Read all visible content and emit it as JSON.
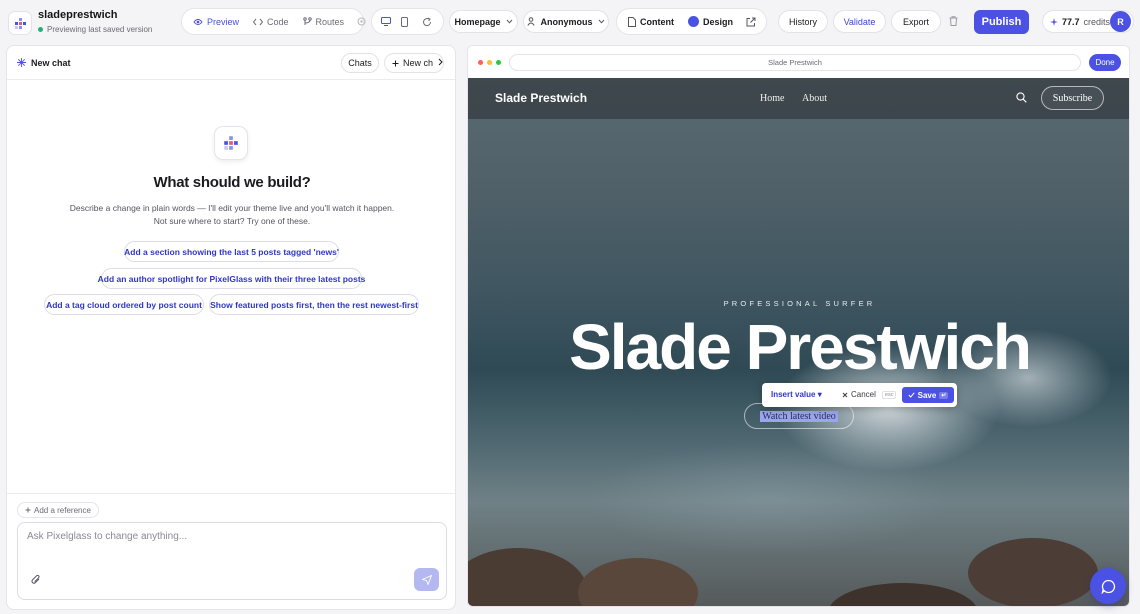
{
  "project": {
    "name": "sladeprestwich",
    "status": "Previewing last saved version"
  },
  "view_tabs": [
    {
      "label": "Preview",
      "icon": "eye-icon",
      "active": true
    },
    {
      "label": "Code",
      "icon": "code-icon",
      "active": false
    },
    {
      "label": "Routes",
      "icon": "routes-icon",
      "active": false
    }
  ],
  "page_select": {
    "value": "Homepage"
  },
  "audience_select": {
    "value": "Anonymous"
  },
  "mode": {
    "content": "Content",
    "design": "Design"
  },
  "actions": {
    "history": "History",
    "validate": "Validate",
    "export": "Export",
    "publish": "Publish"
  },
  "credits": {
    "value": "77.7",
    "label": "credits"
  },
  "user": {
    "initial": "R"
  },
  "chat": {
    "title": "New chat",
    "chats_button": "Chats",
    "new_chat_button": "New ch",
    "empty_title": "What should we build?",
    "empty_desc_line1": "Describe a change in plain words — I'll edit your theme live and you'll watch it happen.",
    "empty_desc_line2": "Not sure where to start? Try one of these.",
    "suggestions": [
      "Add a section showing the last 5 posts tagged 'news'",
      "Add an author spotlight for PixelGlass with their three latest posts",
      "Add a tag cloud ordered by post count",
      "Show featured posts first, then the rest newest-first"
    ],
    "add_reference": "Add a reference",
    "composer_placeholder": "Ask Pixelglass to change anything..."
  },
  "preview": {
    "url": "Slade Prestwich",
    "done": "Done",
    "site": {
      "brand": "Slade Prestwich",
      "nav": [
        "Home",
        "About"
      ],
      "subscribe": "Subscribe",
      "kicker": "PROFESSIONAL SURFER",
      "hero": "Slade Prestwich",
      "cta": "Watch latest video"
    },
    "edit_popover": {
      "insert": "Insert value",
      "insert_caret": "▾",
      "cancel": "Cancel",
      "cancel_key": "esc",
      "save": "Save",
      "save_key": "↵"
    }
  },
  "colors": {
    "accent": "#4b52e3",
    "link": "#2f37c8",
    "status_green": "#22b07d"
  }
}
